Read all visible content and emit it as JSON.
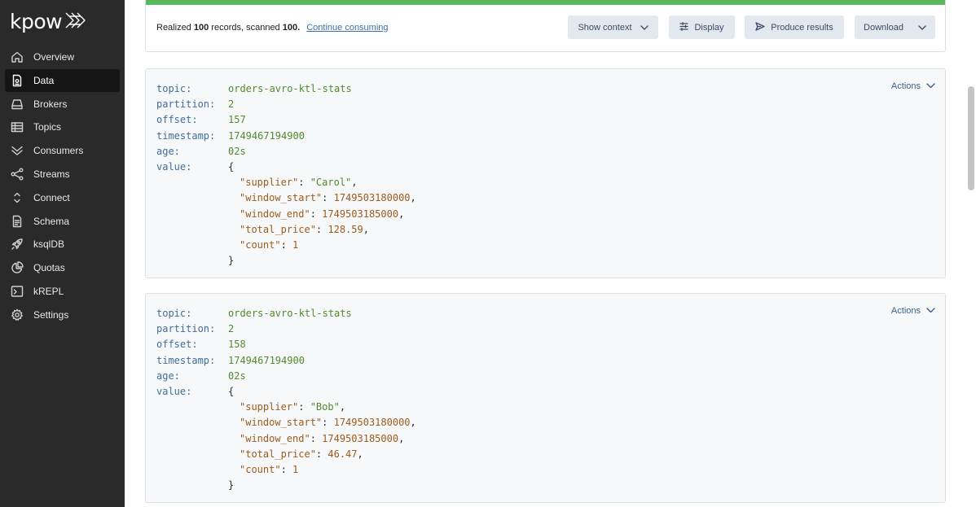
{
  "brand": {
    "name": "kpow"
  },
  "sidebar": {
    "items": [
      {
        "label": "Overview",
        "icon": "home-icon",
        "active": false
      },
      {
        "label": "Data",
        "icon": "document-icon",
        "active": true
      },
      {
        "label": "Brokers",
        "icon": "server-icon",
        "active": false
      },
      {
        "label": "Topics",
        "icon": "table-icon",
        "active": false
      },
      {
        "label": "Consumers",
        "icon": "chevrons-down-icon",
        "active": false
      },
      {
        "label": "Streams",
        "icon": "share-icon",
        "active": false
      },
      {
        "label": "Connect",
        "icon": "expand-vertical-icon",
        "active": false
      },
      {
        "label": "Schema",
        "icon": "file-icon",
        "active": false
      },
      {
        "label": "ksqlDB",
        "icon": "rocket-icon",
        "active": false
      },
      {
        "label": "Quotas",
        "icon": "pie-chart-icon",
        "active": false
      },
      {
        "label": "kREPL",
        "icon": "terminal-icon",
        "active": false
      },
      {
        "label": "Settings",
        "icon": "gear-icon",
        "active": false
      }
    ]
  },
  "status": {
    "prefix": "Realized",
    "realized": "100",
    "mid": "records, scanned",
    "scanned": "100",
    "suffix": ".",
    "continue_label": "Continue consuming",
    "progress_color": "#5cb85c"
  },
  "toolbar": {
    "show_context": "Show context",
    "display": "Display",
    "produce_results": "Produce results",
    "download": "Download"
  },
  "field_labels": {
    "topic": "topic:",
    "partition": "partition:",
    "offset": "offset:",
    "timestamp": "timestamp:",
    "age": "age:",
    "value": "value:"
  },
  "records": [
    {
      "actions_label": "Actions",
      "topic": "orders-avro-ktl-stats",
      "partition": "2",
      "offset": "157",
      "timestamp": "1749467194900",
      "age": "02s",
      "value": {
        "open": "{",
        "close": "}",
        "lines": [
          {
            "key": "\"supplier\"",
            "value": "\"Carol\"",
            "kind": "string",
            "sep": ","
          },
          {
            "key": "\"window_start\"",
            "value": "1749503180000",
            "kind": "number",
            "sep": ","
          },
          {
            "key": "\"window_end\"",
            "value": "1749503185000",
            "kind": "number",
            "sep": ","
          },
          {
            "key": "\"total_price\"",
            "value": "128.59",
            "kind": "number",
            "sep": ","
          },
          {
            "key": "\"count\"",
            "value": "1",
            "kind": "number",
            "sep": ""
          }
        ]
      }
    },
    {
      "actions_label": "Actions",
      "topic": "orders-avro-ktl-stats",
      "partition": "2",
      "offset": "158",
      "timestamp": "1749467194900",
      "age": "02s",
      "value": {
        "open": "{",
        "close": "}",
        "lines": [
          {
            "key": "\"supplier\"",
            "value": "\"Bob\"",
            "kind": "string",
            "sep": ","
          },
          {
            "key": "\"window_start\"",
            "value": "1749503180000",
            "kind": "number",
            "sep": ","
          },
          {
            "key": "\"window_end\"",
            "value": "1749503185000",
            "kind": "number",
            "sep": ","
          },
          {
            "key": "\"total_price\"",
            "value": "46.47",
            "kind": "number",
            "sep": ","
          },
          {
            "key": "\"count\"",
            "value": "1",
            "kind": "number",
            "sep": ""
          }
        ]
      }
    }
  ]
}
